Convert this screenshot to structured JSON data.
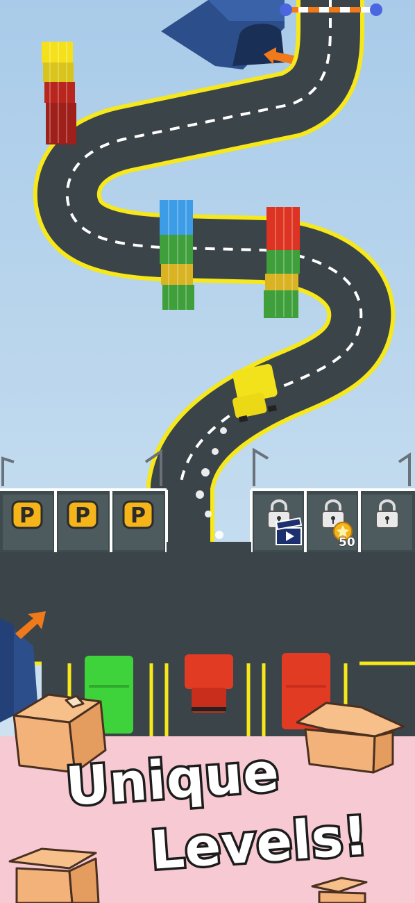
{
  "banner": {
    "line1": "Unique",
    "line2": "Levels!"
  },
  "parking": {
    "open_slots": [
      {
        "label": "P"
      },
      {
        "label": "P"
      },
      {
        "label": "P"
      }
    ],
    "locked_slots": [
      {
        "icon": "lock-icon",
        "unlock": "watch-ad",
        "unlock_icon": "video-clapper-icon"
      },
      {
        "icon": "lock-icon",
        "unlock": "coins",
        "unlock_icon": "coin-star-icon",
        "cost": "50"
      },
      {
        "icon": "lock-icon"
      }
    ]
  },
  "vehicles": {
    "player_truck_color": "#f2e21c",
    "parked": [
      {
        "color": "#3ed33a"
      },
      {
        "color": "#e23b23"
      },
      {
        "color": "#e23b23"
      }
    ]
  },
  "cargo_stacks": [
    {
      "colors": [
        "#f4e01b",
        "#d8c41a",
        "#b8261e",
        "#9f1f1a"
      ]
    },
    {
      "colors": [
        "#3d9ce6",
        "#3f9f3b",
        "#d9b322",
        "#3f9f3b"
      ]
    },
    {
      "colors": [
        "#dd3322",
        "#3f9f3b",
        "#d9b322",
        "#3f9f3b"
      ]
    }
  ],
  "colors": {
    "road": "#3b4448",
    "road_edge": "#f6e81a",
    "arrow": "#f07a1a",
    "banner_bg": "#f7c9d3"
  }
}
